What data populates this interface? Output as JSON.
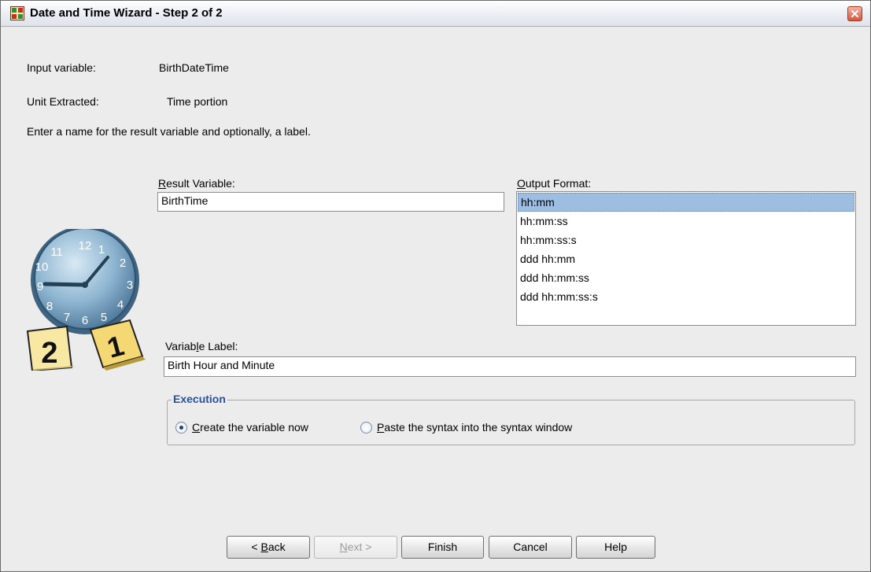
{
  "window": {
    "title": "Date and Time Wizard - Step 2 of 2"
  },
  "info": {
    "input_variable_label": "Input variable:",
    "input_variable_value": "BirthDateTime",
    "unit_extracted_label": "Unit Extracted:",
    "unit_extracted_value": "Time portion",
    "instruction": "Enter a name for the result variable and optionally, a label."
  },
  "result_variable": {
    "label_mnemonic": "R",
    "label_rest": "esult Variable:",
    "value": "BirthTime"
  },
  "output_format": {
    "label_mnemonic": "O",
    "label_rest": "utput Format:",
    "options": [
      "hh:mm",
      "hh:mm:ss",
      "hh:mm:ss:s",
      "ddd hh:mm",
      "ddd hh:mm:ss",
      "ddd hh:mm:ss:s"
    ],
    "selected": "hh:mm"
  },
  "variable_label": {
    "label_before": "Variab",
    "label_mnemonic": "l",
    "label_after": "e Label:",
    "value": "Birth Hour and Minute"
  },
  "execution": {
    "title": "Execution",
    "create_mnemonic": "C",
    "create_rest": "reate the variable now",
    "paste_mnemonic": "P",
    "paste_rest": "aste the syntax into the syntax window",
    "selected": "create"
  },
  "illustration": {
    "clock_numbers": [
      "12",
      "1",
      "2",
      "3",
      "4",
      "5",
      "6",
      "7",
      "8",
      "9",
      "10",
      "11"
    ],
    "calendar_left": "2",
    "calendar_right": "1"
  },
  "buttons": {
    "back_prefix": "< ",
    "back_mnemonic": "B",
    "back_rest": "ack",
    "next_mnemonic": "N",
    "next_rest": "ext >",
    "finish": "Finish",
    "cancel": "Cancel",
    "help": "Help"
  },
  "colors": {
    "selection": "#9dbee0",
    "group_title": "#2451a0",
    "dialog_bg": "#ececec"
  }
}
